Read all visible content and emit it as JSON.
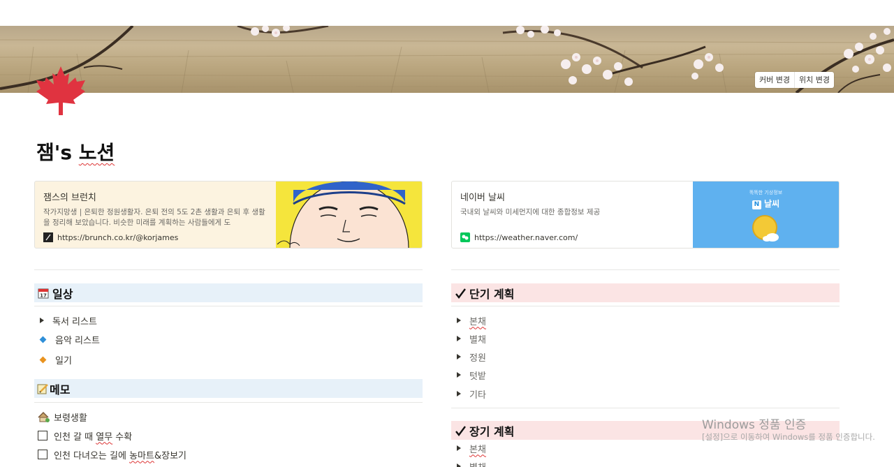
{
  "cover": {
    "change_cover": "커버 변경",
    "reposition": "위치 변경"
  },
  "page": {
    "icon": "maple-leaf-icon",
    "title_prefix": "잼's ",
    "title_word": "노션"
  },
  "bookmarks": [
    {
      "title": "잼스의 브런치",
      "description": "작가지망생 | 은퇴한 정원생활자. 은퇴 전의 5도 2촌 생활과 은퇴 후 생활을 정리해 보았습니다. 비슷한 미래를 계획하는 사람들에게 도",
      "url": "https://brunch.co.kr/@korjames",
      "favicon": "brunch-icon"
    },
    {
      "title": "네이버 날씨",
      "description": "국내외 날씨와 미세먼지에 대한 종합정보 제공",
      "url": "https://weather.naver.com/",
      "favicon": "naver-icon",
      "image_caption": "똑똑한 기상정보",
      "image_title": "날씨",
      "image_badge": "N"
    }
  ],
  "left": {
    "daily": {
      "heading": "일상",
      "icon": "calendar-icon",
      "items": [
        {
          "label": "독서 리스트",
          "bullet": "toggle"
        },
        {
          "label": "음악 리스트",
          "bullet": "diamond-blue"
        },
        {
          "label": "일기",
          "bullet": "diamond-orange"
        }
      ]
    },
    "memo": {
      "heading": "메모",
      "icon": "memo-icon",
      "items": [
        {
          "label": "보령생활",
          "bullet": "house-icon"
        },
        {
          "label_a": "인천 갈 때 ",
          "label_b": "열무",
          "label_c": " 수확",
          "bullet": "checkbox"
        },
        {
          "label_a": "인천 다녀오는 길에 ",
          "label_b": "농마트",
          "label_c": "&장보기",
          "bullet": "checkbox"
        }
      ]
    }
  },
  "right": {
    "short_term": {
      "heading": "단기 계획",
      "icon": "checkmark-icon",
      "items": [
        "본채",
        "별채",
        "정원",
        "텃밭",
        "기타"
      ]
    },
    "long_term": {
      "heading": "장기 계획",
      "icon": "checkmark-icon",
      "items": [
        "본채",
        "별채"
      ]
    }
  },
  "watermark": {
    "line1": "Windows 정품 인증",
    "line2": "[설정]으로 이동하여 Windows를 정품 인증합니다."
  },
  "colors": {
    "heading_blue_bg": "#e7f1f9",
    "heading_red_bg": "#fbe4e4",
    "maple_red": "#e03340",
    "bullet_blue": "#2f8fd8",
    "bullet_orange": "#e9931f",
    "naver_green": "#03c75a"
  }
}
